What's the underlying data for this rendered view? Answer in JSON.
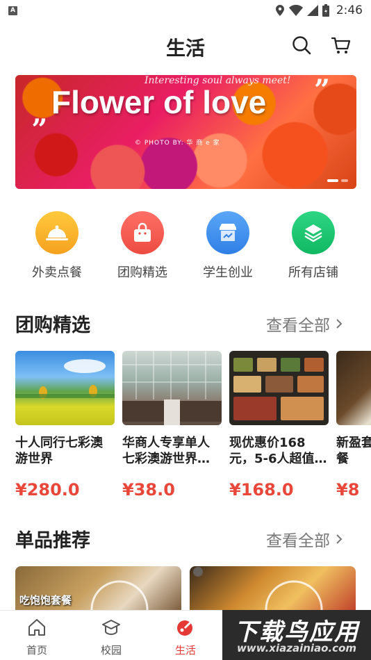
{
  "status_bar": {
    "time": "2:46",
    "notification_letter": "A"
  },
  "header": {
    "title": "生活"
  },
  "banner": {
    "top_text": "Interesting soul always meet!",
    "title": "Flower of love",
    "credit": "© PHOTO BY: 华 商 e 家",
    "quote_open": "„",
    "quote_close": "”",
    "active_slide": 1,
    "slide_count": 2
  },
  "categories": [
    {
      "label": "外卖点餐",
      "icon": "food-cloche-icon",
      "color": "#f7b22a"
    },
    {
      "label": "团购精选",
      "icon": "shopping-bag-icon",
      "color": "#f0564b"
    },
    {
      "label": "学生创业",
      "icon": "shop-icon",
      "color": "#3d8ff0"
    },
    {
      "label": "所有店铺",
      "icon": "layers-icon",
      "color": "#18c26e"
    }
  ],
  "group_section": {
    "title": "团购精选",
    "see_all": "查看全部",
    "items": [
      {
        "name": "十人同行七彩澳游世界",
        "price": "¥280.0"
      },
      {
        "name": "华商人专享单人七彩澳游世界…",
        "price": "¥38.0"
      },
      {
        "name": "现优惠价168元，5-6人超值…",
        "price": "¥168.0"
      },
      {
        "name": "新盈套餐",
        "price": "¥8"
      }
    ]
  },
  "recommend_section": {
    "title": "单品推荐",
    "see_all": "查看全部",
    "items": [
      {
        "overlay_text": "吃饱饱套餐"
      },
      {
        "overlay_text": ""
      }
    ]
  },
  "bottom_nav": [
    {
      "label": "首页",
      "icon": "home-icon",
      "active": false
    },
    {
      "label": "校园",
      "icon": "campus-icon",
      "active": false
    },
    {
      "label": "生活",
      "icon": "life-icon",
      "active": true
    }
  ],
  "watermark": {
    "title": "下载鸟应用",
    "url": "www.xiazainiao.com"
  },
  "colors": {
    "accent": "#e53935",
    "price": "#e8473a"
  }
}
